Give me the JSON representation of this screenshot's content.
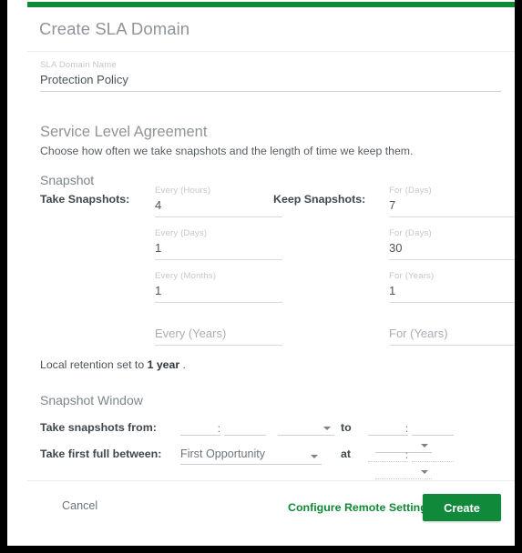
{
  "theme": {
    "accent_green": "#0f8a34",
    "button_green": "#11893a",
    "label_gray": "#8e9499",
    "text_gray": "#4c5359"
  },
  "dialog": {
    "title": "Create SLA Domain"
  },
  "domain_name": {
    "label": "SLA Domain Name",
    "value": "Protection Policy"
  },
  "sla": {
    "heading": "Service Level Agreement",
    "subtitle": "Choose how often we take snapshots and the length of time we keep them."
  },
  "snapshot": {
    "heading": "Snapshot",
    "take_label": "Take Snapshots:",
    "keep_label": "Keep Snapshots:",
    "take_fields": [
      {
        "label": "Every (Hours)",
        "value": "4",
        "placeholder": "",
        "empty": false
      },
      {
        "label": "Every (Days)",
        "value": "1",
        "placeholder": "",
        "empty": false
      },
      {
        "label": "Every (Months)",
        "value": "1",
        "placeholder": "",
        "empty": false
      },
      {
        "label": "",
        "value": "",
        "placeholder": "Every (Years)",
        "empty": true
      }
    ],
    "keep_fields": [
      {
        "label": "For (Days)",
        "value": "7",
        "placeholder": "",
        "empty": false
      },
      {
        "label": "For (Days)",
        "value": "30",
        "placeholder": "",
        "empty": false
      },
      {
        "label": "For (Years)",
        "value": "1",
        "placeholder": "",
        "empty": false
      },
      {
        "label": "",
        "value": "",
        "placeholder": "For (Years)",
        "empty": true
      }
    ]
  },
  "retention": {
    "prefix": "Local retention set to ",
    "value": "1 year",
    "suffix": " ."
  },
  "snapshot_window": {
    "heading": "Snapshot Window",
    "from_label": "Take snapshots from:",
    "between_label": "Take first full between:",
    "conjunction_to": "to",
    "conjunction_at": "at",
    "colon": ":",
    "from_time": {
      "hour": "",
      "minute": "",
      "meridiem": ""
    },
    "to_time": {
      "hour": "",
      "minute": "",
      "meridiem": ""
    },
    "at_time": {
      "hour": "",
      "minute": "",
      "meridiem": ""
    },
    "opportunity_select": {
      "value": "First Opportunity",
      "options": [
        "First Opportunity"
      ]
    }
  },
  "footer": {
    "cancel_label": "Cancel",
    "remote_settings_label": "Configure Remote Settings",
    "create_label": "Create"
  }
}
